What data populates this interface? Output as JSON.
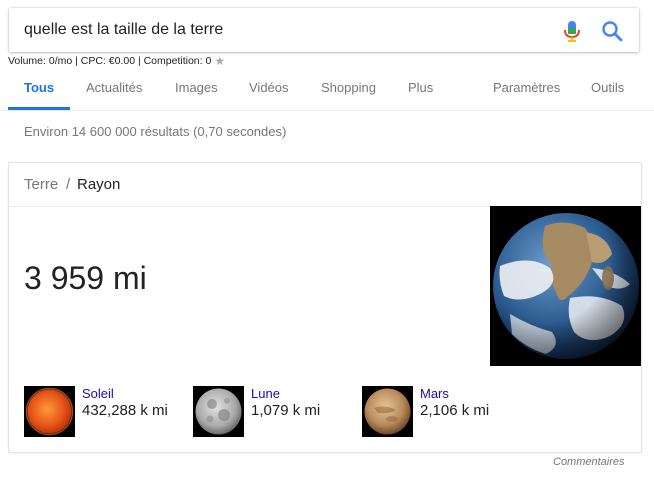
{
  "search": {
    "query": "quelle est la taille de la terre"
  },
  "seo_bar": {
    "text": "Volume: 0/mo | CPC: €0.00 | Competition: 0",
    "star": "★"
  },
  "tabs": [
    {
      "label": "Tous",
      "active": true
    },
    {
      "label": "Actualités"
    },
    {
      "label": "Images"
    },
    {
      "label": "Vidéos"
    },
    {
      "label": "Shopping"
    },
    {
      "label": "Plus"
    },
    {
      "label": "Paramètres"
    },
    {
      "label": "Outils"
    }
  ],
  "result_stats": "Environ 14 600 000 résultats (0,70 secondes)",
  "card": {
    "breadcrumb": {
      "parent": "Terre",
      "separator": "/",
      "current": "Rayon"
    },
    "answer": "3 959 mi",
    "related": [
      {
        "name": "Soleil",
        "value": "432,288 k mi"
      },
      {
        "name": "Lune",
        "value": "1,079 k mi"
      },
      {
        "name": "Mars",
        "value": "2,106 k mi"
      }
    ]
  },
  "feedback": "Commentaires",
  "colors": {
    "accent": "#1a73e8",
    "link": "#1a0dab",
    "muted": "#777777"
  },
  "icons": {
    "mic": "microphone-icon",
    "search": "search-icon",
    "star": "star-icon"
  }
}
